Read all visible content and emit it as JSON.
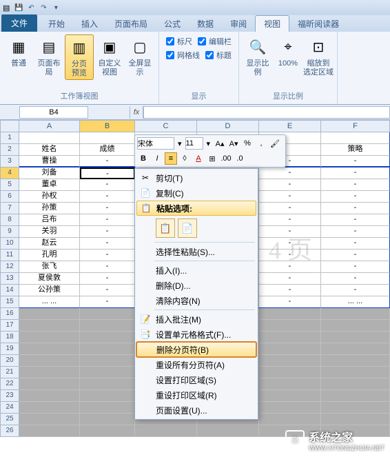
{
  "qat": {
    "save_icon": "💾",
    "undo_icon": "↶",
    "redo_icon": "↷"
  },
  "tabs": {
    "file": "文件",
    "items": [
      "开始",
      "插入",
      "页面布局",
      "公式",
      "数据",
      "审阅",
      "视图",
      "福昕阅读器"
    ],
    "active_index": 6
  },
  "ribbon": {
    "group1": {
      "label": "工作簿视图",
      "buttons": [
        {
          "label": "普通"
        },
        {
          "label": "页面布局"
        },
        {
          "label": "分页\n预览",
          "active": true
        },
        {
          "label": "自定义视图"
        },
        {
          "label": "全屏显示"
        }
      ]
    },
    "group2": {
      "label": "显示",
      "checks": [
        {
          "label": "标尺",
          "checked": true
        },
        {
          "label": "编辑栏",
          "checked": true
        },
        {
          "label": "网格线",
          "checked": true
        },
        {
          "label": "标题",
          "checked": true
        }
      ]
    },
    "group3": {
      "label": "显示比例",
      "buttons": [
        {
          "label": "显示比例"
        },
        {
          "label": "100%"
        },
        {
          "label": "缩放到\n选定区域"
        }
      ]
    }
  },
  "namebox": {
    "value": "B4",
    "fx": "fx"
  },
  "columns": [
    "A",
    "B",
    "C",
    "D",
    "E",
    "F"
  ],
  "selected_col_index": 1,
  "selected_row_index": 4,
  "rows": [
    {
      "n": 1,
      "cells": [
        "",
        "",
        "",
        "",
        "",
        ""
      ]
    },
    {
      "n": 2,
      "cells": [
        "姓名",
        "成绩",
        "",
        "",
        "",
        "策略"
      ]
    },
    {
      "n": 3,
      "cells": [
        "曹操",
        "-",
        "-",
        "-",
        "-",
        "-"
      ],
      "page_break_after": true
    },
    {
      "n": 4,
      "cells": [
        "刘备",
        "-",
        "-",
        "-",
        "-",
        "-"
      ],
      "selected_col": 1
    },
    {
      "n": 5,
      "cells": [
        "董卓",
        "-",
        "-",
        "-",
        "-",
        "-"
      ]
    },
    {
      "n": 6,
      "cells": [
        "孙权",
        "-",
        "-",
        "-",
        "-",
        "-"
      ]
    },
    {
      "n": 7,
      "cells": [
        "孙策",
        "-",
        "-",
        "-",
        "-",
        "-"
      ]
    },
    {
      "n": 8,
      "cells": [
        "吕布",
        "-",
        "-",
        "-",
        "-",
        "-"
      ]
    },
    {
      "n": 9,
      "cells": [
        "关羽",
        "-",
        "-",
        "-",
        "-",
        "-"
      ]
    },
    {
      "n": 10,
      "cells": [
        "赵云",
        "-",
        "-",
        "-",
        "-",
        "-"
      ]
    },
    {
      "n": 11,
      "cells": [
        "孔明",
        "-",
        "-",
        "-",
        "-",
        "-"
      ]
    },
    {
      "n": 12,
      "cells": [
        "张飞",
        "-",
        "-",
        "-",
        "-",
        "-"
      ]
    },
    {
      "n": 13,
      "cells": [
        "夏侯敦",
        "-",
        "-",
        "-",
        "-",
        "-"
      ]
    },
    {
      "n": 14,
      "cells": [
        "公孙策",
        "-",
        "-",
        "-",
        "-",
        "-"
      ]
    },
    {
      "n": 15,
      "cells": [
        "... ...",
        "-",
        "-",
        "-",
        "-",
        "... ..."
      ],
      "last_data": true
    }
  ],
  "empty_rows": [
    16,
    17,
    18,
    19,
    20,
    21,
    22,
    23,
    24,
    25,
    26
  ],
  "watermark_text": "4 页",
  "mini_toolbar": {
    "font": "宋体",
    "size": "11",
    "grow": "A▴",
    "shrink": "A▾",
    "currency": "%",
    "comma": ",",
    "bold": "B",
    "italic": "I",
    "align": "≡",
    "fill": "◊",
    "font_color": "A",
    "border": "⊞",
    "decimals": ".0"
  },
  "context_menu": {
    "items": [
      {
        "icon": "✂",
        "label": "剪切(T)"
      },
      {
        "icon": "📄",
        "label": "复制(C)"
      },
      {
        "icon": "📋",
        "label": "粘贴选项:",
        "is_section": true,
        "highlighted": true
      },
      {
        "paste_options": true
      },
      {
        "label": "选择性粘贴(S)...",
        "sep_before": true
      },
      {
        "label": "插入(I)...",
        "sep_before": true
      },
      {
        "label": "删除(D)..."
      },
      {
        "label": "清除内容(N)"
      },
      {
        "icon": "📝",
        "label": "插入批注(M)",
        "sep_before": true
      },
      {
        "icon": "📑",
        "label": "设置单元格格式(F)..."
      },
      {
        "label": "删除分页符(B)",
        "highlighted": true,
        "boxed": true
      },
      {
        "label": "重设所有分页符(A)"
      },
      {
        "label": "设置打印区域(S)"
      },
      {
        "label": "重设打印区域(R)"
      },
      {
        "label": "页面设置(U)..."
      }
    ]
  },
  "brand": {
    "name": "系统之家",
    "url": "WWW.XITONGZHIJIA.NET"
  }
}
